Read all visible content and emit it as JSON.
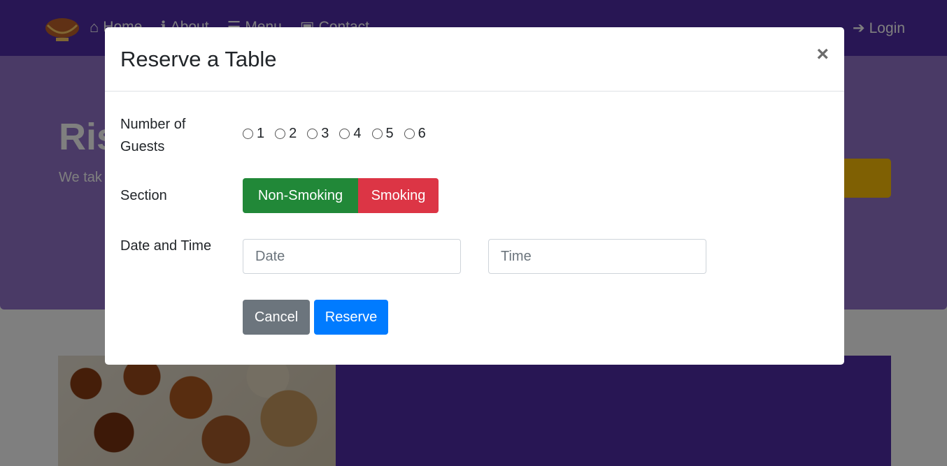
{
  "nav": {
    "items": [
      {
        "label": "Home",
        "icon": "home-icon"
      },
      {
        "label": "About",
        "icon": "info-icon"
      },
      {
        "label": "Menu",
        "icon": "list-icon"
      },
      {
        "label": "Contact",
        "icon": "address-card-icon"
      }
    ],
    "login_label": "Login",
    "login_icon": "sign-in-icon"
  },
  "jumbotron": {
    "title": "Ris",
    "text": "We tak a uniqu tickle y"
  },
  "modal": {
    "title": "Reserve a Table",
    "close_label": "×",
    "guests_label": "Number of Guests",
    "guest_options": [
      "1",
      "2",
      "3",
      "4",
      "5",
      "6"
    ],
    "section_label": "Section",
    "section_options": [
      "Non-Smoking",
      "Smoking"
    ],
    "datetime_label": "Date and Time",
    "date_placeholder": "Date",
    "time_placeholder": "Time",
    "cancel_label": "Cancel",
    "reserve_label": "Reserve"
  },
  "colors": {
    "navbar": "#512da8",
    "jumbotron": "#9575cd",
    "success": "#218838",
    "danger": "#dc3545",
    "primary": "#007bff",
    "secondary": "#6c757d",
    "warning": "#ffc107"
  }
}
